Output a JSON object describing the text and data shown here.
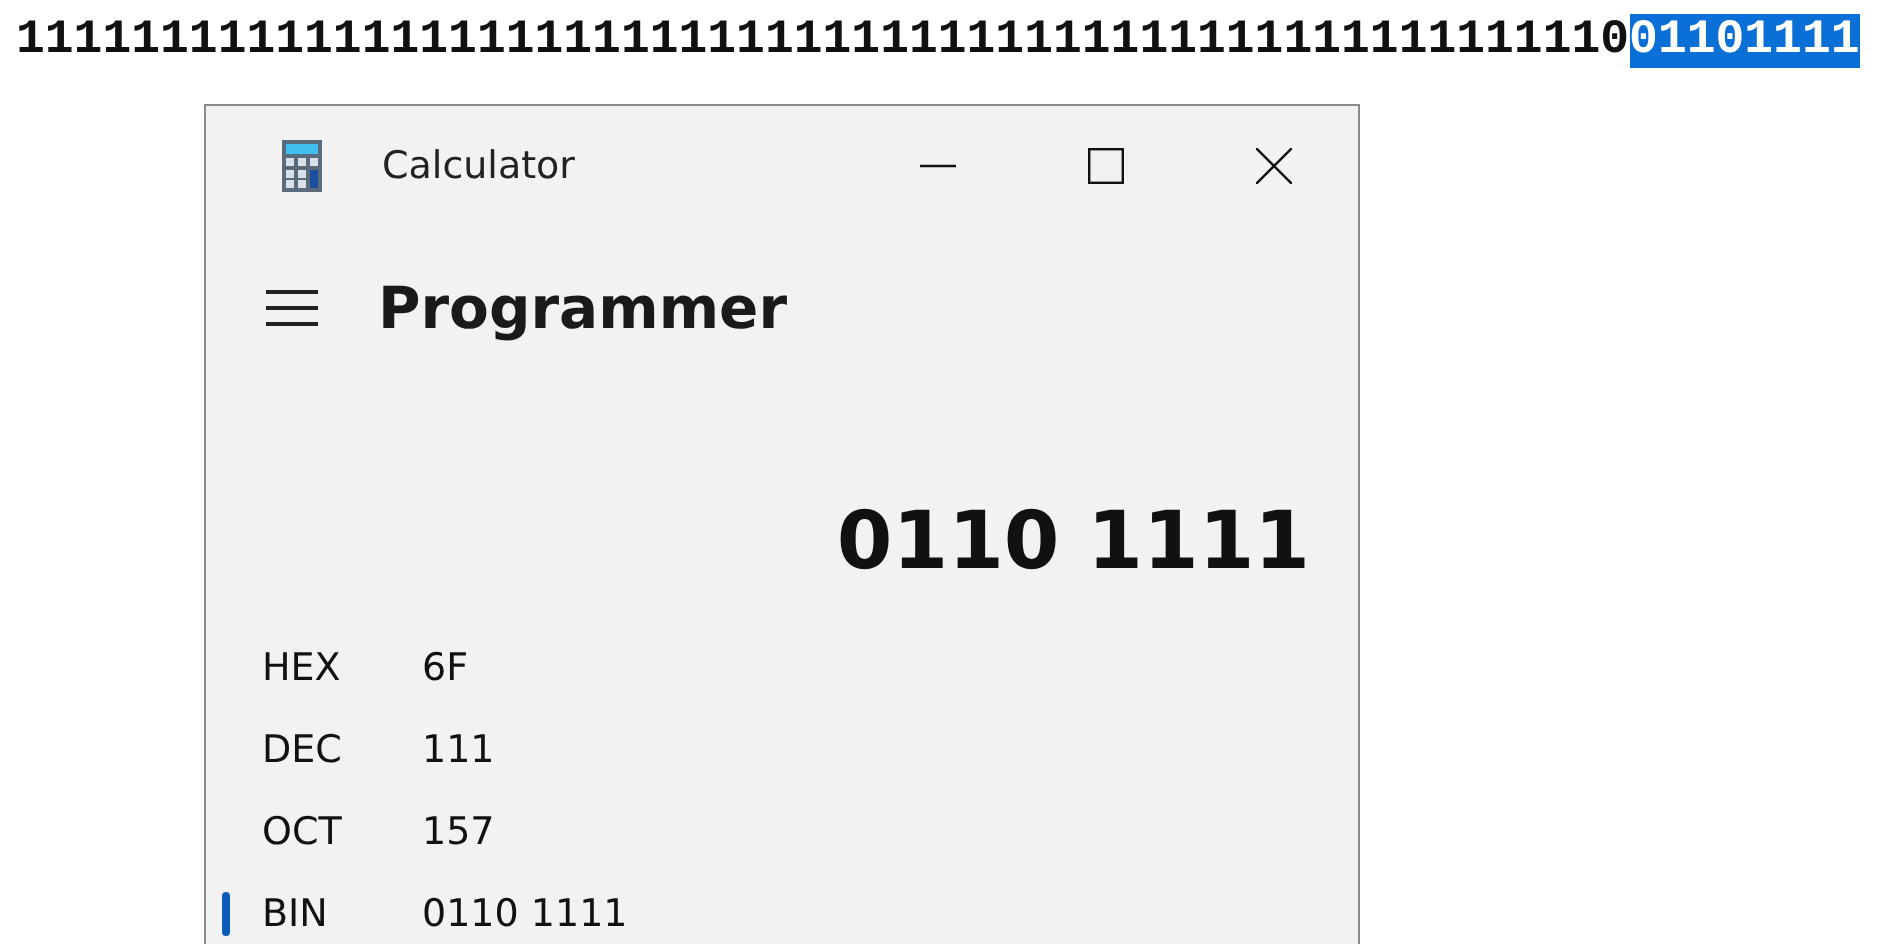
{
  "bit_string": [
    {
      "text": "1111111111111111111111111111111111111111111111111111111",
      "selected": false
    },
    {
      "text": "0",
      "selected": false
    },
    {
      "text": "01101111",
      "selected": true
    }
  ],
  "window": {
    "title": "Calculator"
  },
  "mode": "Programmer",
  "display": "0110 1111",
  "radix_rows": [
    {
      "label": "HEX",
      "value": "6F",
      "selected": false
    },
    {
      "label": "DEC",
      "value": "111",
      "selected": false
    },
    {
      "label": "OCT",
      "value": "157",
      "selected": false
    },
    {
      "label": "BIN",
      "value": "0110 1111",
      "selected": true
    }
  ]
}
